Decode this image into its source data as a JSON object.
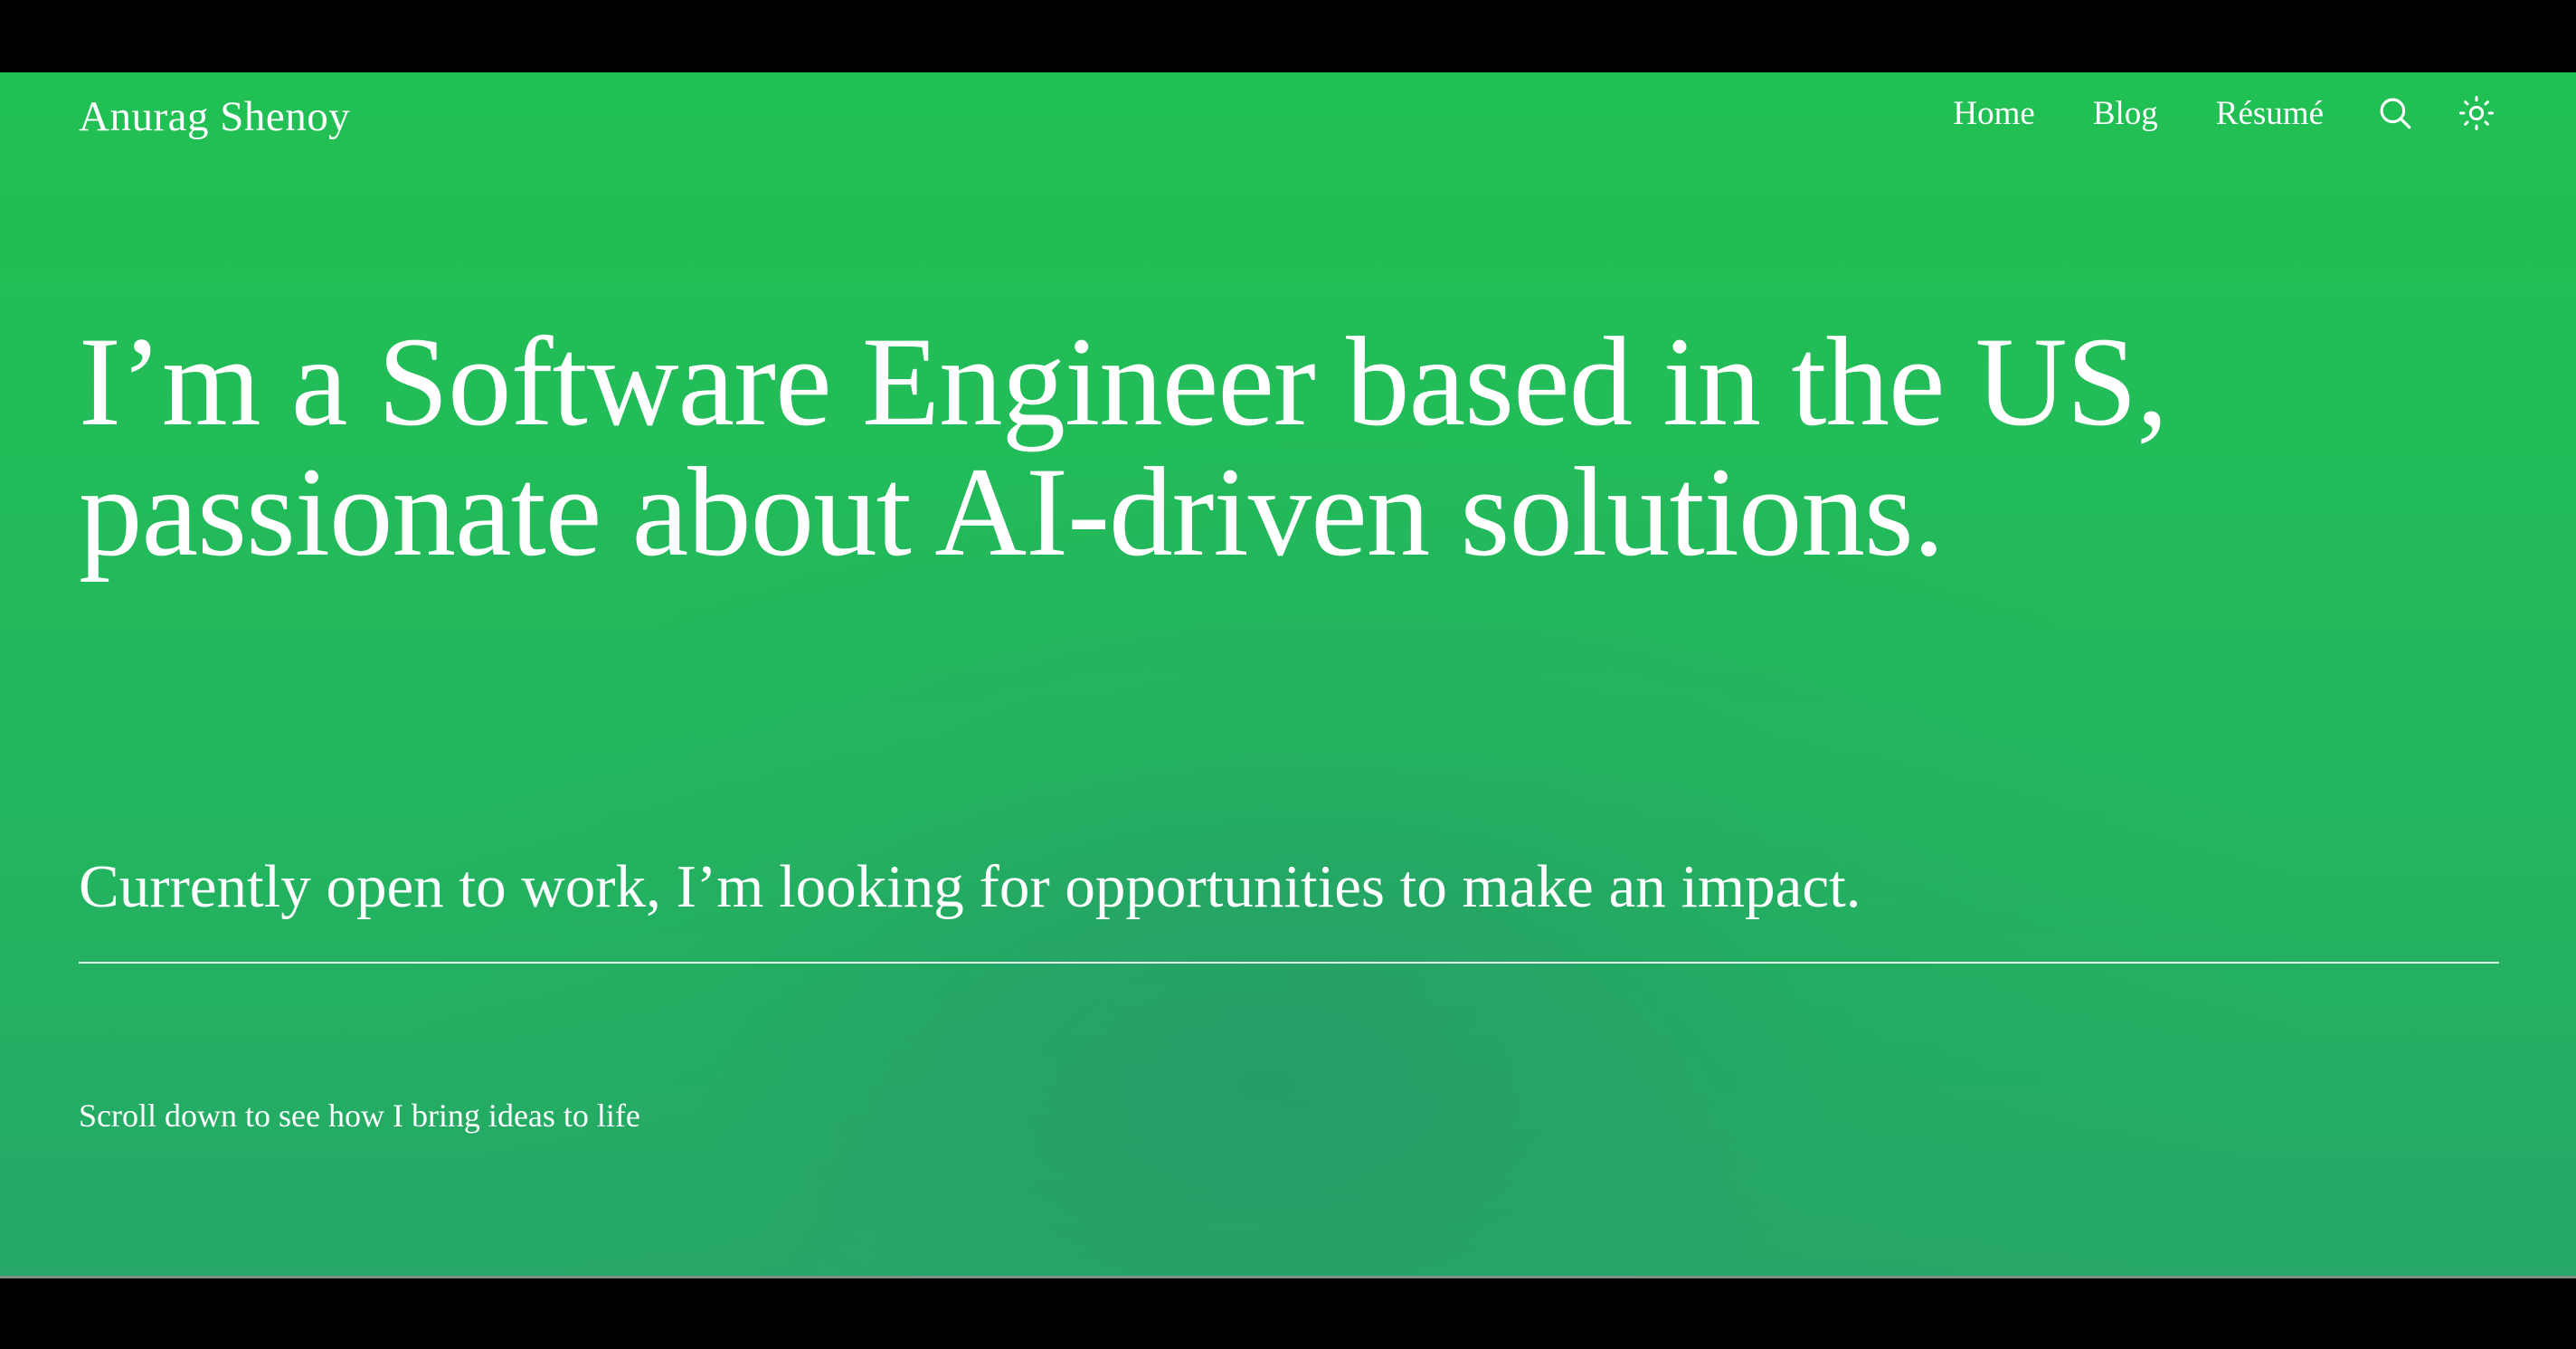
{
  "site": {
    "brand": "Anurag Shenoy"
  },
  "nav": {
    "items": [
      {
        "label": "Home"
      },
      {
        "label": "Blog"
      },
      {
        "label": "Résumé"
      }
    ],
    "search_icon": "search-icon",
    "theme_icon": "sun-icon"
  },
  "hero": {
    "headline": "I’m a Software Engineer based in the US, passionate about AI-driven solutions.",
    "subline": "Currently open to work, I’m looking for opportunities to make an impact.",
    "scroll_hint": "Scroll down to see how I bring ideas to life"
  },
  "colors": {
    "background_green": "#21c053",
    "text": "#ffffff"
  }
}
